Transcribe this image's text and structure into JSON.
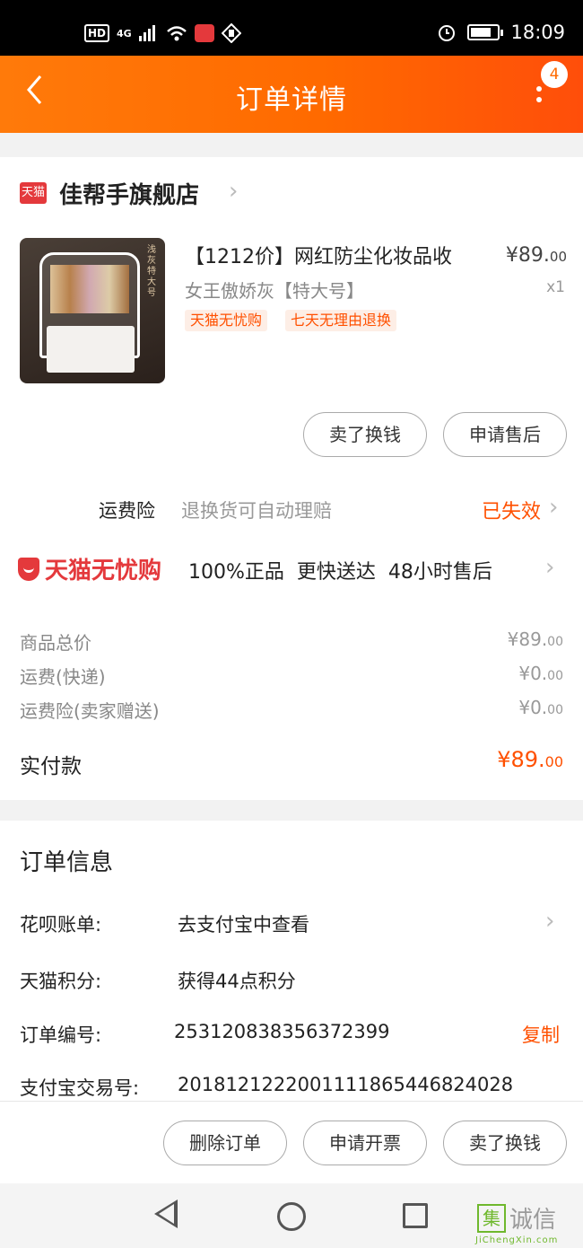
{
  "status_bar": {
    "hd": "HD",
    "network": "4G",
    "time": "18:09"
  },
  "header": {
    "title": "订单详情",
    "badge_count": "4"
  },
  "store": {
    "logo_text": "天猫",
    "name": "佳帮手旗舰店"
  },
  "product": {
    "title": "【1212价】网红防尘化妆品收",
    "sku": "女王傲娇灰【特大号】",
    "price_main": "¥89.",
    "price_cents": "00",
    "qty": "x1",
    "image_tag": "浅灰特大号",
    "tags": [
      "天猫无忧购",
      "七天无理由退换"
    ]
  },
  "product_buttons": {
    "sell": "卖了换钱",
    "after_sale": "申请售后"
  },
  "insurance": {
    "label": "运费险",
    "desc": "退换货可自动理赔",
    "status": "已失效"
  },
  "guarantee": {
    "logo": "天猫无忧购",
    "text": "100%正品  更快送达  48小时售后"
  },
  "summary": [
    {
      "label": "商品总价",
      "value_main": "¥89.",
      "value_cents": "00"
    },
    {
      "label": "运费(快递)",
      "value_main": "¥0.",
      "value_cents": "00"
    },
    {
      "label": "运费险(卖家赠送)",
      "value_main": "¥0.",
      "value_cents": "00"
    }
  ],
  "paid": {
    "label": "实付款",
    "value_main": "¥89.",
    "value_cents": "00"
  },
  "order_info": {
    "heading": "订单信息",
    "rows": [
      {
        "label": "花呗账单:",
        "value": "去支付宝中查看"
      },
      {
        "label": "天猫积分:",
        "value": "获得44点积分"
      },
      {
        "label": "订单编号:",
        "value": "253120838356372399",
        "action": "复制"
      },
      {
        "label": "支付宝交易号:",
        "value": "2018121222001111865446824028"
      }
    ]
  },
  "bottom_actions": {
    "delete": "删除订单",
    "invoice": "申请开票",
    "sell": "卖了换钱"
  },
  "watermark": {
    "icon_char": "集",
    "text": "诚信",
    "url": "JiChengXin.com"
  }
}
